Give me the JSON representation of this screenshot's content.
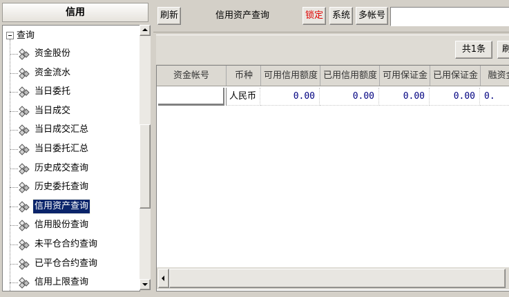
{
  "left_panel": {
    "title": "信用",
    "tree": {
      "root_label": "查询",
      "items": [
        {
          "label": "资金股份"
        },
        {
          "label": "资金流水"
        },
        {
          "label": "当日委托"
        },
        {
          "label": "当日成交"
        },
        {
          "label": "当日成交汇总"
        },
        {
          "label": "当日委托汇总"
        },
        {
          "label": "历史成交查询"
        },
        {
          "label": "历史委托查询"
        },
        {
          "label": "信用资产查询",
          "selected": true
        },
        {
          "label": "信用股份查询"
        },
        {
          "label": "未平仓合约查询"
        },
        {
          "label": "已平仓合约查询"
        },
        {
          "label": "信用上限查询"
        }
      ]
    }
  },
  "toolbar": {
    "refresh_label": "刷新",
    "title": "信用资产查询",
    "lock_label": "锁定",
    "system_label": "系统",
    "multi_account_label": "多帐号",
    "account_value": ""
  },
  "subbar": {
    "count_label": "共1条",
    "refresh_label": "刷"
  },
  "grid": {
    "columns": [
      "资金帐号",
      "币种",
      "可用信用额度",
      "已用信用额度",
      "可用保证金",
      "已用保证金",
      "融资金"
    ],
    "rows": [
      [
        "",
        "人民币",
        "0.00",
        "0.00",
        "0.00",
        "0.00",
        "0."
      ]
    ]
  },
  "colors": {
    "selected_bg": "#0a246a",
    "lock_text": "#e00000",
    "value_text": "#000080"
  }
}
